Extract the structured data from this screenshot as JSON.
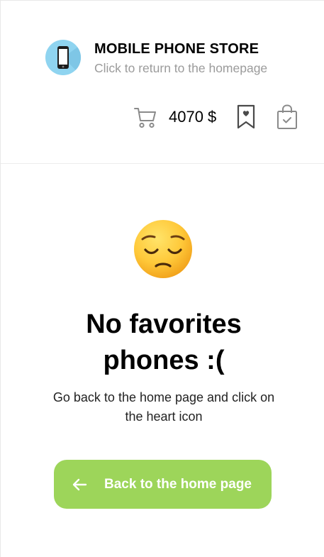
{
  "header": {
    "title": "MOBILE PHONE STORE",
    "subtitle": "Click to return to the homepage",
    "cart_total": "4070 $",
    "logo_icon": "phone-icon",
    "cart_icon": "cart-icon",
    "bookmark_icon": "bookmark-heart-icon",
    "bag_icon": "shopping-bag-check-icon"
  },
  "empty_state": {
    "emoji": "pensive-face-emoji",
    "title": "No favorites phones :(",
    "description": "Go back to the home page and click on the heart icon",
    "back_button_label": "Back to the home page",
    "back_button_icon": "arrow-left-icon"
  },
  "colors": {
    "accent": "#9dd55a",
    "logo_bg": "#8fd4f0",
    "muted_text": "#9b9b9b"
  }
}
